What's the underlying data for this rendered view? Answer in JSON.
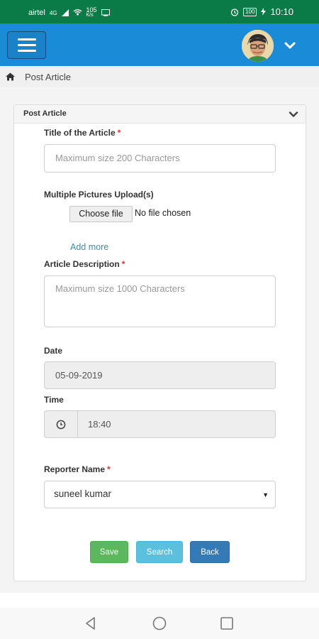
{
  "status_bar": {
    "carrier": "airtel",
    "network": "4G",
    "speed_value": "105",
    "speed_unit": "K/s",
    "battery": "100",
    "time": "10:10",
    "icons": [
      "signal-icon",
      "wifi-hotspot-icon",
      "screen-cast-icon",
      "alarm-icon",
      "battery-icon",
      "charging-icon"
    ]
  },
  "app_bar": {
    "menu_icon": "hamburger-menu-icon",
    "avatar_icon": "user-avatar",
    "dropdown_icon": "chevron-down-icon",
    "color": "#1a8bd6"
  },
  "breadcrumb": {
    "icon": "home-icon",
    "label": "Post Article"
  },
  "panel": {
    "title": "Post Article",
    "collapse_icon": "chevron-down-icon"
  },
  "form": {
    "title_field": {
      "label": "Title of the Article",
      "required_mark": "*",
      "placeholder": "Maximum size 200 Characters"
    },
    "pictures_field": {
      "label": "Multiple Pictures Upload(s)",
      "button_label": "Choose file",
      "status": "No file chosen",
      "add_more": "Add more"
    },
    "description_field": {
      "label": "Article Description",
      "required_mark": "*",
      "placeholder": "Maximum size 1000 Characters"
    },
    "date_field": {
      "label": "Date",
      "value": "05-09-2019"
    },
    "time_field": {
      "label": "Time",
      "icon": "clock-icon",
      "value": "18:40"
    },
    "reporter_field": {
      "label": "Reporter Name",
      "required_mark": "*",
      "selected": "suneel kumar"
    }
  },
  "buttons": {
    "save": "Save",
    "search": "Search",
    "back": "Back"
  },
  "colors": {
    "status_bar": "#0a7a47",
    "app_bar": "#1a8bd6",
    "save": "#5cb85c",
    "search": "#5bc0de",
    "back": "#337ab7",
    "required": "#d9302c"
  },
  "nav_bar": {
    "icons": [
      "nav-back-icon",
      "nav-home-icon",
      "nav-recents-icon"
    ]
  }
}
